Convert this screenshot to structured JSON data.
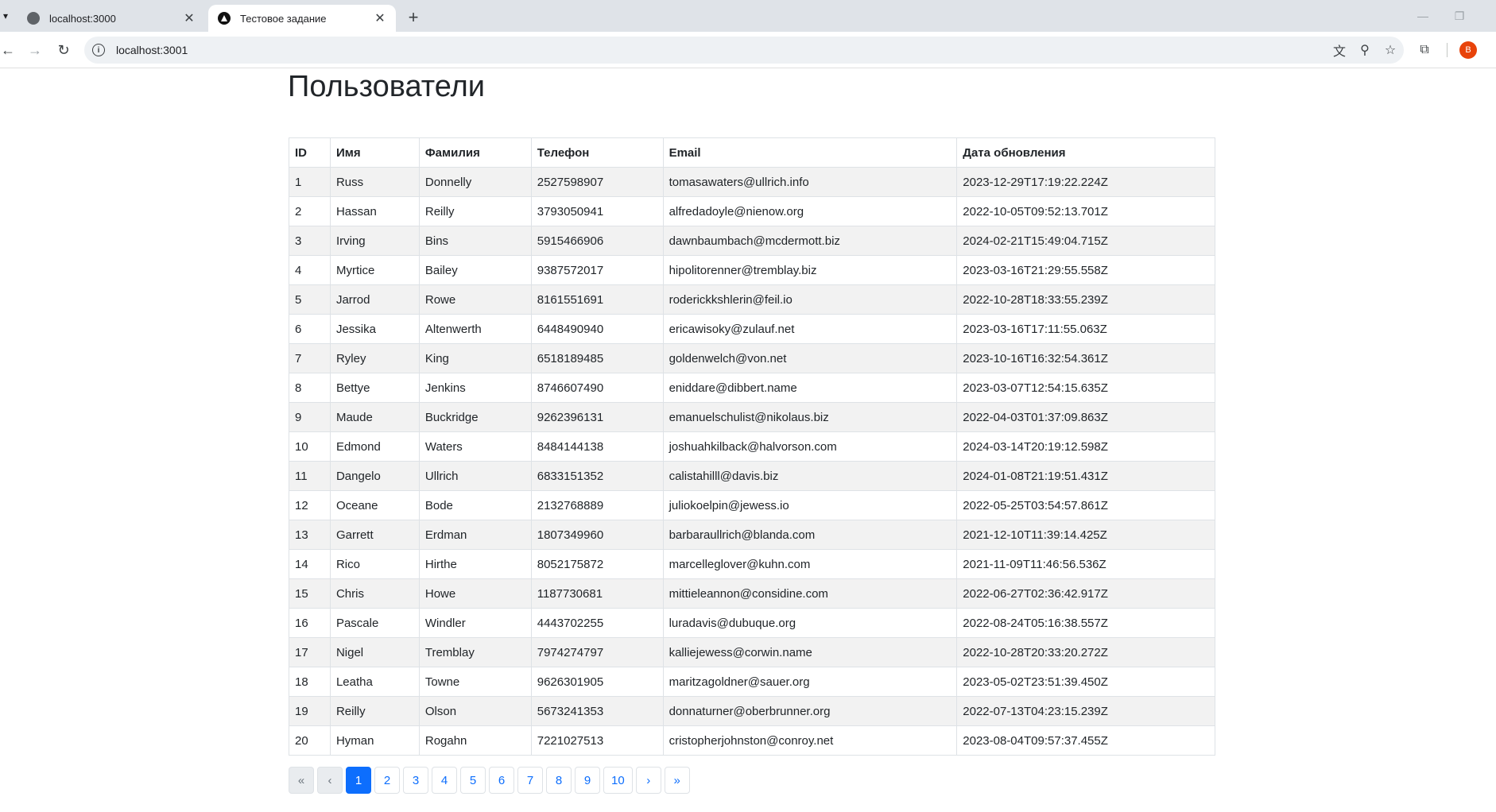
{
  "browser": {
    "tabs": [
      {
        "title": "localhost:3000",
        "active": false
      },
      {
        "title": "Тестовое задание",
        "active": true
      }
    ],
    "url": "localhost:3001",
    "profile_initial": "B",
    "icons": {
      "tab_menu": "▾",
      "close": "✕",
      "new_tab": "+",
      "back": "←",
      "forward": "→",
      "reload": "↻",
      "info": "i",
      "translate": "文",
      "zoom": "⚲",
      "bookmark": "☆",
      "extensions": "⧉",
      "minimize": "—",
      "restore": "❐"
    }
  },
  "page": {
    "title": "Пользователи",
    "table": {
      "headers": [
        "ID",
        "Имя",
        "Фамилия",
        "Телефон",
        "Email",
        "Дата обновления"
      ],
      "rows": [
        [
          "1",
          "Russ",
          "Donnelly",
          "2527598907",
          "tomasawaters@ullrich.info",
          "2023-12-29T17:19:22.224Z"
        ],
        [
          "2",
          "Hassan",
          "Reilly",
          "3793050941",
          "alfredadoyle@nienow.org",
          "2022-10-05T09:52:13.701Z"
        ],
        [
          "3",
          "Irving",
          "Bins",
          "5915466906",
          "dawnbaumbach@mcdermott.biz",
          "2024-02-21T15:49:04.715Z"
        ],
        [
          "4",
          "Myrtice",
          "Bailey",
          "9387572017",
          "hipolitorenner@tremblay.biz",
          "2023-03-16T21:29:55.558Z"
        ],
        [
          "5",
          "Jarrod",
          "Rowe",
          "8161551691",
          "roderickkshlerin@feil.io",
          "2022-10-28T18:33:55.239Z"
        ],
        [
          "6",
          "Jessika",
          "Altenwerth",
          "6448490940",
          "ericawisoky@zulauf.net",
          "2023-03-16T17:11:55.063Z"
        ],
        [
          "7",
          "Ryley",
          "King",
          "6518189485",
          "goldenwelch@von.net",
          "2023-10-16T16:32:54.361Z"
        ],
        [
          "8",
          "Bettye",
          "Jenkins",
          "8746607490",
          "eniddare@dibbert.name",
          "2023-03-07T12:54:15.635Z"
        ],
        [
          "9",
          "Maude",
          "Buckridge",
          "9262396131",
          "emanuelschulist@nikolaus.biz",
          "2022-04-03T01:37:09.863Z"
        ],
        [
          "10",
          "Edmond",
          "Waters",
          "8484144138",
          "joshuahkilback@halvorson.com",
          "2024-03-14T20:19:12.598Z"
        ],
        [
          "11",
          "Dangelo",
          "Ullrich",
          "6833151352",
          "calistahilll@davis.biz",
          "2024-01-08T21:19:51.431Z"
        ],
        [
          "12",
          "Oceane",
          "Bode",
          "2132768889",
          "juliokoelpin@jewess.io",
          "2022-05-25T03:54:57.861Z"
        ],
        [
          "13",
          "Garrett",
          "Erdman",
          "1807349960",
          "barbaraullrich@blanda.com",
          "2021-12-10T11:39:14.425Z"
        ],
        [
          "14",
          "Rico",
          "Hirthe",
          "8052175872",
          "marcelleglover@kuhn.com",
          "2021-11-09T11:46:56.536Z"
        ],
        [
          "15",
          "Chris",
          "Howe",
          "1187730681",
          "mittieleannon@considine.com",
          "2022-06-27T02:36:42.917Z"
        ],
        [
          "16",
          "Pascale",
          "Windler",
          "4443702255",
          "luradavis@dubuque.org",
          "2022-08-24T05:16:38.557Z"
        ],
        [
          "17",
          "Nigel",
          "Tremblay",
          "7974274797",
          "kalliejewess@corwin.name",
          "2022-10-28T20:33:20.272Z"
        ],
        [
          "18",
          "Leatha",
          "Towne",
          "9626301905",
          "maritzagoldner@sauer.org",
          "2023-05-02T23:51:39.450Z"
        ],
        [
          "19",
          "Reilly",
          "Olson",
          "5673241353",
          "donnaturner@oberbrunner.org",
          "2022-07-13T04:23:15.239Z"
        ],
        [
          "20",
          "Hyman",
          "Rogahn",
          "7221027513",
          "cristopherjohnston@conroy.net",
          "2023-08-04T09:57:37.455Z"
        ]
      ]
    },
    "pagination": {
      "first": "«",
      "prev": "‹",
      "pages": [
        "1",
        "2",
        "3",
        "4",
        "5",
        "6",
        "7",
        "8",
        "9",
        "10"
      ],
      "current": "1",
      "next": "›",
      "last": "»"
    }
  }
}
